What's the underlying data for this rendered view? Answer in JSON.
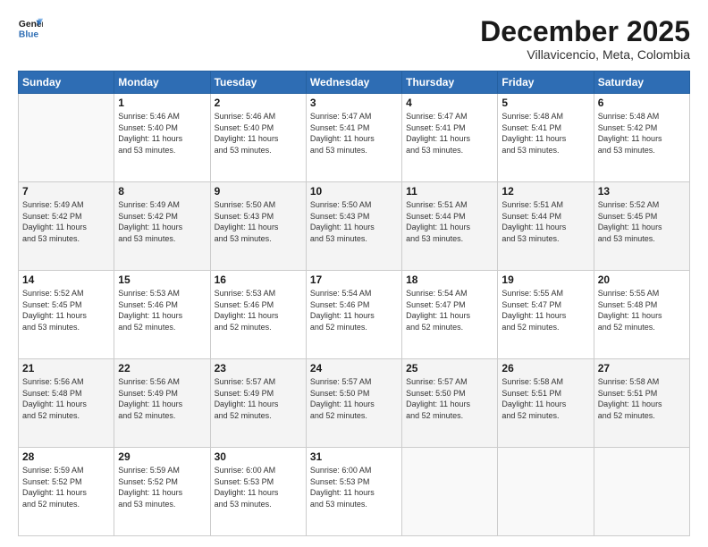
{
  "logo": {
    "line1": "General",
    "line2": "Blue"
  },
  "header": {
    "month": "December 2025",
    "location": "Villavencio, Meta, Colombia"
  },
  "days_of_week": [
    "Sunday",
    "Monday",
    "Tuesday",
    "Wednesday",
    "Thursday",
    "Friday",
    "Saturday"
  ],
  "weeks": [
    [
      {
        "day": "",
        "info": ""
      },
      {
        "day": "1",
        "info": "Sunrise: 5:46 AM\nSunset: 5:40 PM\nDaylight: 11 hours\nand 53 minutes."
      },
      {
        "day": "2",
        "info": "Sunrise: 5:46 AM\nSunset: 5:40 PM\nDaylight: 11 hours\nand 53 minutes."
      },
      {
        "day": "3",
        "info": "Sunrise: 5:47 AM\nSunset: 5:41 PM\nDaylight: 11 hours\nand 53 minutes."
      },
      {
        "day": "4",
        "info": "Sunrise: 5:47 AM\nSunset: 5:41 PM\nDaylight: 11 hours\nand 53 minutes."
      },
      {
        "day": "5",
        "info": "Sunrise: 5:48 AM\nSunset: 5:41 PM\nDaylight: 11 hours\nand 53 minutes."
      },
      {
        "day": "6",
        "info": "Sunrise: 5:48 AM\nSunset: 5:42 PM\nDaylight: 11 hours\nand 53 minutes."
      }
    ],
    [
      {
        "day": "7",
        "info": "Sunrise: 5:49 AM\nSunset: 5:42 PM\nDaylight: 11 hours\nand 53 minutes."
      },
      {
        "day": "8",
        "info": "Sunrise: 5:49 AM\nSunset: 5:42 PM\nDaylight: 11 hours\nand 53 minutes."
      },
      {
        "day": "9",
        "info": "Sunrise: 5:50 AM\nSunset: 5:43 PM\nDaylight: 11 hours\nand 53 minutes."
      },
      {
        "day": "10",
        "info": "Sunrise: 5:50 AM\nSunset: 5:43 PM\nDaylight: 11 hours\nand 53 minutes."
      },
      {
        "day": "11",
        "info": "Sunrise: 5:51 AM\nSunset: 5:44 PM\nDaylight: 11 hours\nand 53 minutes."
      },
      {
        "day": "12",
        "info": "Sunrise: 5:51 AM\nSunset: 5:44 PM\nDaylight: 11 hours\nand 53 minutes."
      },
      {
        "day": "13",
        "info": "Sunrise: 5:52 AM\nSunset: 5:45 PM\nDaylight: 11 hours\nand 53 minutes."
      }
    ],
    [
      {
        "day": "14",
        "info": "Sunrise: 5:52 AM\nSunset: 5:45 PM\nDaylight: 11 hours\nand 53 minutes."
      },
      {
        "day": "15",
        "info": "Sunrise: 5:53 AM\nSunset: 5:46 PM\nDaylight: 11 hours\nand 52 minutes."
      },
      {
        "day": "16",
        "info": "Sunrise: 5:53 AM\nSunset: 5:46 PM\nDaylight: 11 hours\nand 52 minutes."
      },
      {
        "day": "17",
        "info": "Sunrise: 5:54 AM\nSunset: 5:46 PM\nDaylight: 11 hours\nand 52 minutes."
      },
      {
        "day": "18",
        "info": "Sunrise: 5:54 AM\nSunset: 5:47 PM\nDaylight: 11 hours\nand 52 minutes."
      },
      {
        "day": "19",
        "info": "Sunrise: 5:55 AM\nSunset: 5:47 PM\nDaylight: 11 hours\nand 52 minutes."
      },
      {
        "day": "20",
        "info": "Sunrise: 5:55 AM\nSunset: 5:48 PM\nDaylight: 11 hours\nand 52 minutes."
      }
    ],
    [
      {
        "day": "21",
        "info": "Sunrise: 5:56 AM\nSunset: 5:48 PM\nDaylight: 11 hours\nand 52 minutes."
      },
      {
        "day": "22",
        "info": "Sunrise: 5:56 AM\nSunset: 5:49 PM\nDaylight: 11 hours\nand 52 minutes."
      },
      {
        "day": "23",
        "info": "Sunrise: 5:57 AM\nSunset: 5:49 PM\nDaylight: 11 hours\nand 52 minutes."
      },
      {
        "day": "24",
        "info": "Sunrise: 5:57 AM\nSunset: 5:50 PM\nDaylight: 11 hours\nand 52 minutes."
      },
      {
        "day": "25",
        "info": "Sunrise: 5:57 AM\nSunset: 5:50 PM\nDaylight: 11 hours\nand 52 minutes."
      },
      {
        "day": "26",
        "info": "Sunrise: 5:58 AM\nSunset: 5:51 PM\nDaylight: 11 hours\nand 52 minutes."
      },
      {
        "day": "27",
        "info": "Sunrise: 5:58 AM\nSunset: 5:51 PM\nDaylight: 11 hours\nand 52 minutes."
      }
    ],
    [
      {
        "day": "28",
        "info": "Sunrise: 5:59 AM\nSunset: 5:52 PM\nDaylight: 11 hours\nand 52 minutes."
      },
      {
        "day": "29",
        "info": "Sunrise: 5:59 AM\nSunset: 5:52 PM\nDaylight: 11 hours\nand 53 minutes."
      },
      {
        "day": "30",
        "info": "Sunrise: 6:00 AM\nSunset: 5:53 PM\nDaylight: 11 hours\nand 53 minutes."
      },
      {
        "day": "31",
        "info": "Sunrise: 6:00 AM\nSunset: 5:53 PM\nDaylight: 11 hours\nand 53 minutes."
      },
      {
        "day": "",
        "info": ""
      },
      {
        "day": "",
        "info": ""
      },
      {
        "day": "",
        "info": ""
      }
    ]
  ]
}
